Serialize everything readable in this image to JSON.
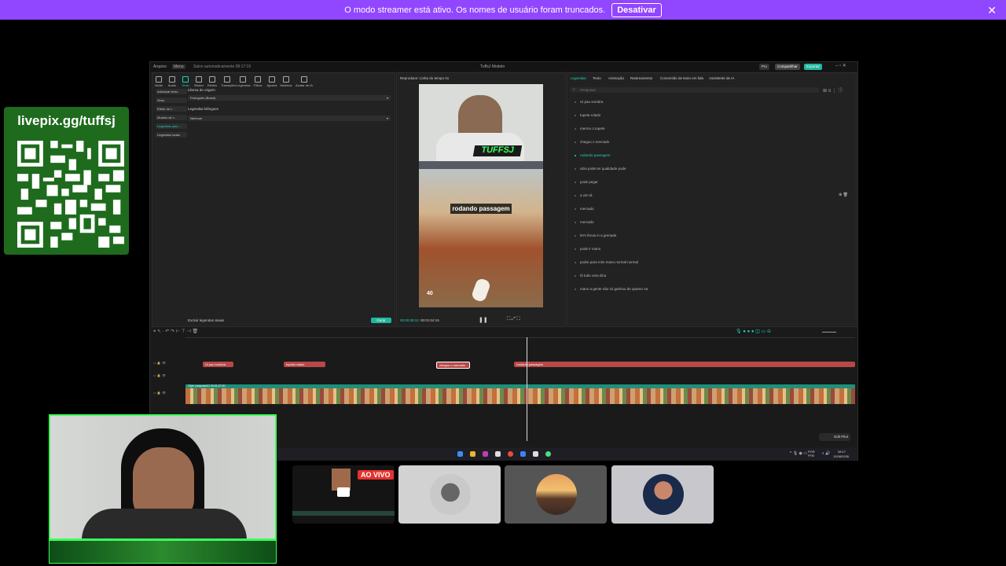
{
  "banner": {
    "message": "O modo streamer está ativo. Os nomes de usuário foram truncados.",
    "action": "Desativar"
  },
  "donation": {
    "label": "livepix.gg/tuffsj"
  },
  "editor": {
    "menu": [
      "Arquivo",
      "Menu"
    ],
    "autosave": "Salvo automaticamente 08:17:15",
    "title": "TuffsJ Modelo",
    "pro_badge": "Pro",
    "share_btn": "Compartilhar",
    "export_btn": "Exportar",
    "toolbar": [
      "Mídia",
      "Áudio",
      "Texto",
      "Sticker",
      "Efeitos",
      "Transições",
      "Legendas",
      "Filtros",
      "Ajustes",
      "Modelos",
      "Avatar de IA"
    ],
    "left_menu": [
      "Adicionar texto",
      "Seus",
      "Efeito de t...",
      "Modelo de t...",
      "Legendas auto...",
      "Legendas locais"
    ],
    "source_lang_label": "Idioma de origem",
    "source_lang_value": "Português (Brasil)",
    "bilingual_label": "Legendas bilíngues",
    "bilingual_value": "Nenhum",
    "clear_label": "Excluir legendas atuais",
    "generate_btn": "Gerar",
    "player_title": "Reprodutor: Linha do tempo 01",
    "time_current": "00:00:09:12",
    "time_total": "00:01:04:15",
    "streamer_tag": "TUFFSJ",
    "subtitle_overlay": "rodando passagem",
    "hud_score": "40",
    "caption_tabs": [
      "Legendas",
      "Texto",
      "Animação",
      "Rastreamento",
      "Conversão de texto em fala",
      "Assistente de IA"
    ],
    "search_placeholder": "Pesquisar",
    "captions": [
      "Ui pau sombra",
      "tupeta rolado",
      "mermo o tupete",
      "chegou o mercado",
      "rodando passagem",
      "ultra pode ter qualidade pode",
      "pode pegar",
      "a vim lá",
      "mercado",
      "mercado",
      "let's throw in a grenade",
      "pode ir mano",
      "podre para mim mano normal normal",
      "tô tudo uma dica",
      "mano a gente não só ganhou de quanto na"
    ],
    "timeline_clips": [
      "Ui pau sombra",
      "tupeta rolado",
      "chegou o mercado",
      "rodando passagem"
    ],
    "video_track_label": "Clipe composto01  00:01:27:00",
    "edit_pilot": "Edit Pilot"
  },
  "taskbar": {
    "lang": "POR PTB",
    "time": "08:17",
    "date": "12/08/2026"
  },
  "tiles": {
    "live_badge": "AO VIVO"
  }
}
